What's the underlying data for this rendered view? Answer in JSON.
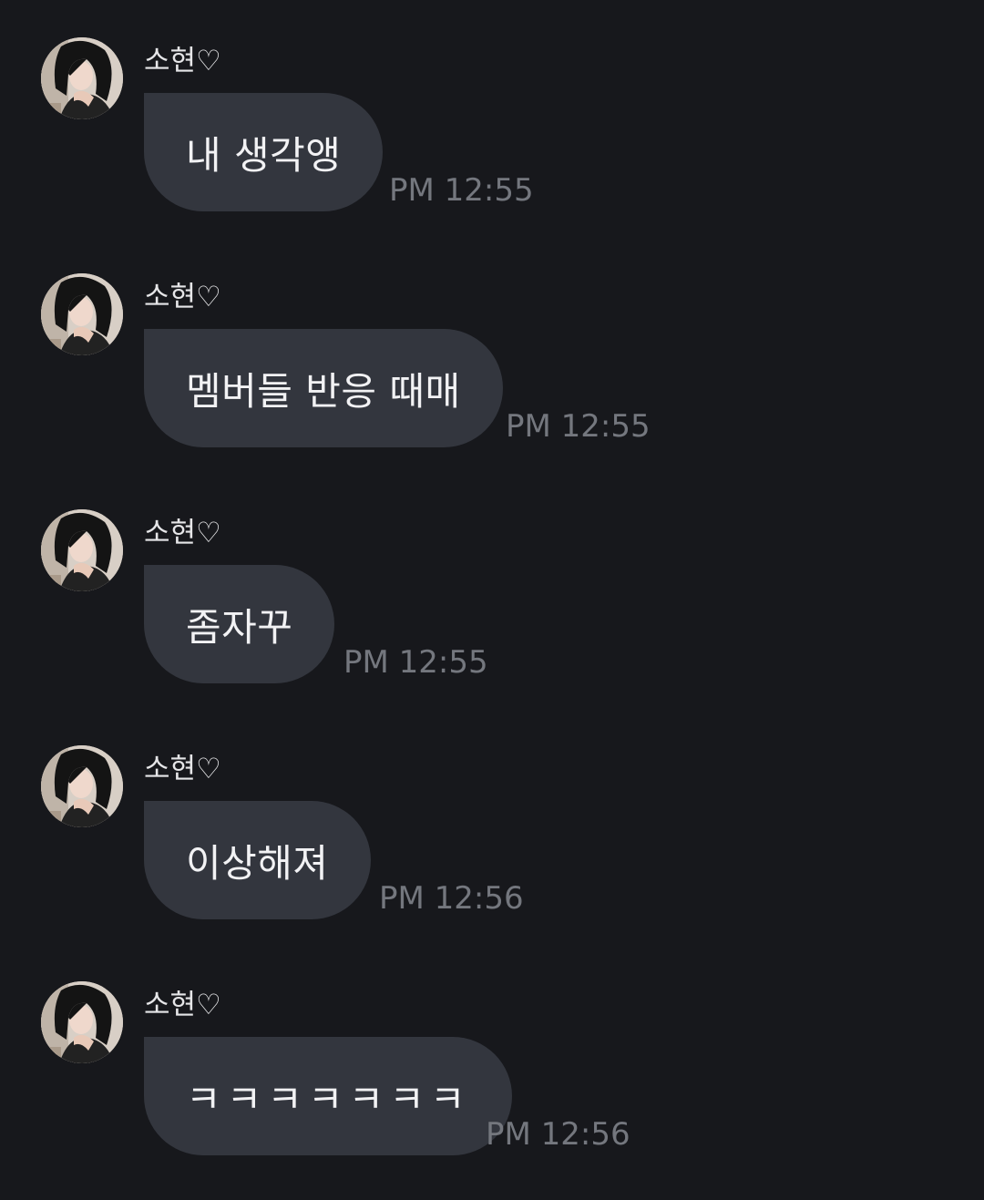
{
  "messages": [
    {
      "sender": "소현♡",
      "text": "내 생각앵",
      "time": "PM 12:55",
      "avatar": "profile-photo"
    },
    {
      "sender": "소현♡",
      "text": "멤버들 반응 때매",
      "time": "PM 12:55",
      "avatar": "profile-photo"
    },
    {
      "sender": "소현♡",
      "text": "좀자꾸",
      "time": "PM 12:55",
      "avatar": "profile-photo"
    },
    {
      "sender": "소현♡",
      "text": "이상해져",
      "time": "PM 12:56",
      "avatar": "profile-photo"
    },
    {
      "sender": "소현♡",
      "text": "ㅋㅋㅋㅋㅋㅋㅋ",
      "time": "PM 12:56",
      "avatar": "profile-photo"
    }
  ],
  "colors": {
    "background": "#17181c",
    "bubble": "#33363e",
    "message_text": "#f2f2f4",
    "timestamp": "#74777e"
  }
}
